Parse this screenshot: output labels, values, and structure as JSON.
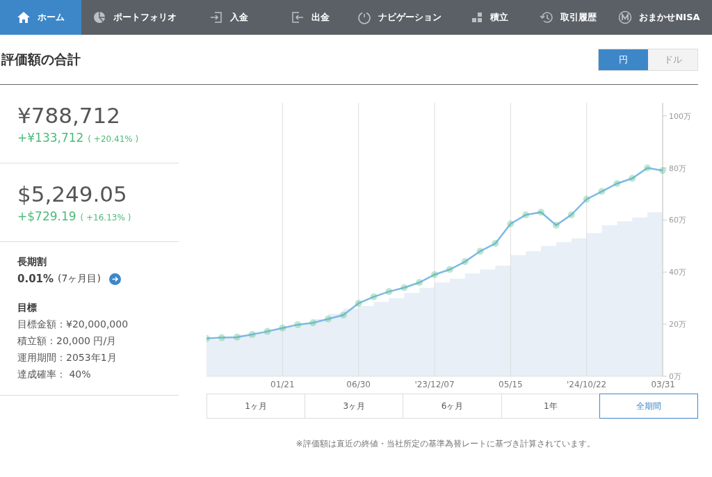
{
  "nav": [
    {
      "label": "ホーム",
      "selected": true
    },
    {
      "label": "ポートフォリオ",
      "selected": false
    },
    {
      "label": "入金",
      "selected": false
    },
    {
      "label": "出金",
      "selected": false
    },
    {
      "label": "ナビゲーション",
      "selected": false
    },
    {
      "label": "積立",
      "selected": false
    },
    {
      "label": "取引履歴",
      "selected": false
    },
    {
      "label": "おまかせNISA",
      "selected": false
    }
  ],
  "header": {
    "title": "評価額の合計",
    "currency_toggle": [
      {
        "label": "円",
        "selected": true
      },
      {
        "label": "ドル",
        "selected": false
      }
    ]
  },
  "summary": [
    {
      "amount": "¥788,712",
      "change": "+¥133,712",
      "change_pct": "( +20.41% )"
    },
    {
      "amount": "$5,249.05",
      "change": "+$729.19",
      "change_pct": "( +16.13% )"
    }
  ],
  "discount": {
    "title": "長期割",
    "rate": "0.01%",
    "months": "(7ヶ月目)"
  },
  "goal": {
    "title": "目標",
    "lines": [
      "目標金額：¥20,000,000",
      "積立額：20,000 円/月",
      "運用期間：2053年1月",
      "達成確率： 40%"
    ]
  },
  "chart": {
    "chart_data": {
      "type": "line",
      "categories": [
        null,
        null,
        null,
        null,
        null,
        "01/21",
        null,
        null,
        null,
        null,
        "06/30",
        null,
        null,
        null,
        null,
        "'23/12/07",
        null,
        null,
        null,
        null,
        "05/15",
        null,
        null,
        null,
        null,
        "'24/10/22",
        null,
        null,
        null,
        null,
        "03/31"
      ],
      "series": [
        {
          "type": "line",
          "marker": true,
          "color": "#7db9e8",
          "values": [
            14.5,
            14.8,
            15,
            16,
            17.2,
            18.5,
            19.8,
            20.5,
            22,
            23.5,
            28,
            30.5,
            32.5,
            34,
            36,
            39,
            41,
            44,
            48,
            51,
            58.5,
            62,
            63,
            58,
            62,
            68,
            71,
            74,
            76,
            80,
            79
          ]
        },
        {
          "type": "area",
          "color": "#e8eff7",
          "values": [
            14,
            15,
            16,
            17,
            18,
            19,
            20,
            22,
            24,
            26,
            27,
            28.5,
            30,
            32,
            34,
            36,
            37.5,
            39.5,
            41,
            42.5,
            46.5,
            48,
            50,
            51.5,
            53,
            55,
            58,
            59.5,
            61,
            63,
            65
          ]
        }
      ],
      "ylim": [
        0,
        105
      ],
      "grid": true,
      "yticks": [
        {
          "value": 0,
          "label": "0万"
        },
        {
          "value": 20,
          "label": "20万"
        },
        {
          "value": 40,
          "label": "40万"
        },
        {
          "value": 60,
          "label": "60万"
        },
        {
          "value": 80,
          "label": "80万"
        },
        {
          "value": 100,
          "label": "100万"
        }
      ]
    },
    "periods": [
      {
        "label": "1ヶ月",
        "selected": false
      },
      {
        "label": "3ヶ月",
        "selected": false
      },
      {
        "label": "6ヶ月",
        "selected": false
      },
      {
        "label": "1年",
        "selected": false
      },
      {
        "label": "全期間",
        "selected": true
      }
    ]
  },
  "footnote": "※評価額は直近の終値・当社所定の基準為替レートに基づき計算されています。"
}
